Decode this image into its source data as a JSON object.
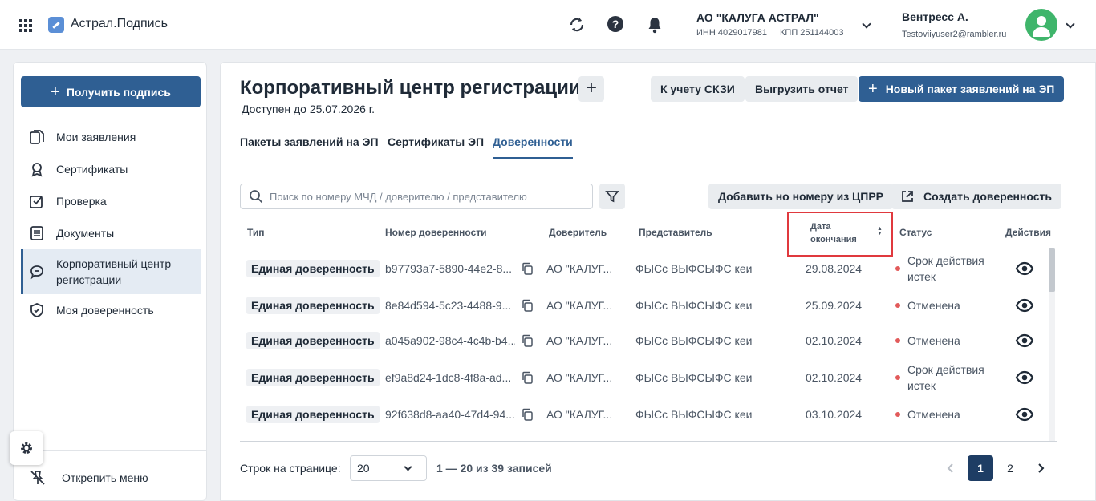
{
  "app": {
    "title": "Астрал.Подпись"
  },
  "header": {
    "org_name": "АО \"КАЛУГА АСТРАЛ\"",
    "org_inn": "ИНН 4029017981",
    "org_kpp": "КПП 251144003",
    "user_name": "Вентресс А.",
    "user_email": "Testoviiyuser2@rambler.ru"
  },
  "sidebar": {
    "get_sign_label": "Получить подпись",
    "items": [
      {
        "label": "Мои заявления",
        "icon": "files-icon"
      },
      {
        "label": "Сертификаты",
        "icon": "award-icon"
      },
      {
        "label": "Проверка",
        "icon": "check-square-icon"
      },
      {
        "label": "Документы",
        "icon": "document-icon"
      },
      {
        "label": "Корпоративный центр регистрации",
        "icon": "chat-icon"
      },
      {
        "label": "Моя доверенность",
        "icon": "shield-check-icon"
      }
    ],
    "unpin_label": "Открепить меню"
  },
  "main": {
    "title": "Корпоративный центр регистрации",
    "available_until": "Доступен до 25.07.2026 г.",
    "btn_skzi": "К учету СКЗИ",
    "btn_export": "Выгрузить отчет",
    "btn_new_package": "Новый пакет заявлений на ЭП",
    "tabs": [
      "Пакеты заявлений на ЭП",
      "Сертификаты ЭП",
      "Доверенности"
    ],
    "active_tab": "Доверенности",
    "search_placeholder": "Поиск по номеру МЧД / доверителю / представителю",
    "btn_add_cprr": "Добавить но номеру из ЦПРР",
    "btn_create_poa": "Создать доверенность"
  },
  "table": {
    "headers": {
      "type": "Тип",
      "number": "Номер доверенности",
      "principal": "Доверитель",
      "representative": "Представитель",
      "end_date_1": "Дата",
      "end_date_2": "окончания",
      "status": "Статус",
      "actions": "Действия"
    },
    "rows": [
      {
        "type": "Единая доверенность",
        "number": "b97793a7-5890-44e2-8...",
        "principal": "АО \"КАЛУГ...",
        "representative": "ФЫСс ВЫФСЫФС кеи",
        "end_date": "29.08.2024",
        "status": "Срок действия истек"
      },
      {
        "type": "Единая доверенность",
        "number": "8e84d594-5c23-4488-9...",
        "principal": "АО \"КАЛУГ...",
        "representative": "ФЫСс ВЫФСЫФС кеи",
        "end_date": "25.09.2024",
        "status": "Отменена"
      },
      {
        "type": "Единая доверенность",
        "number": "a045a902-98c4-4c4b-b4...",
        "principal": "АО \"КАЛУГ...",
        "representative": "ФЫСс ВЫФСЫФС кеи",
        "end_date": "02.10.2024",
        "status": "Отменена"
      },
      {
        "type": "Единая доверенность",
        "number": "ef9a8d24-1dc8-4f8a-ad...",
        "principal": "АО \"КАЛУГ...",
        "representative": "ФЫСс ВЫФСЫФС кеи",
        "end_date": "02.10.2024",
        "status": "Срок действия истек"
      },
      {
        "type": "Единая доверенность",
        "number": "92f638d8-aa40-47d4-94...",
        "principal": "АО \"КАЛУГ...",
        "representative": "ФЫСс ВЫФСЫФС кеи",
        "end_date": "03.10.2024",
        "status": "Отменена"
      }
    ],
    "status_color": "#e25a5a"
  },
  "pagination": {
    "rows_label": "Строк на странице:",
    "rows_value": "20",
    "range": "1 — 20 из 39 записей",
    "pages": [
      "1",
      "2"
    ],
    "current_page": "1"
  }
}
